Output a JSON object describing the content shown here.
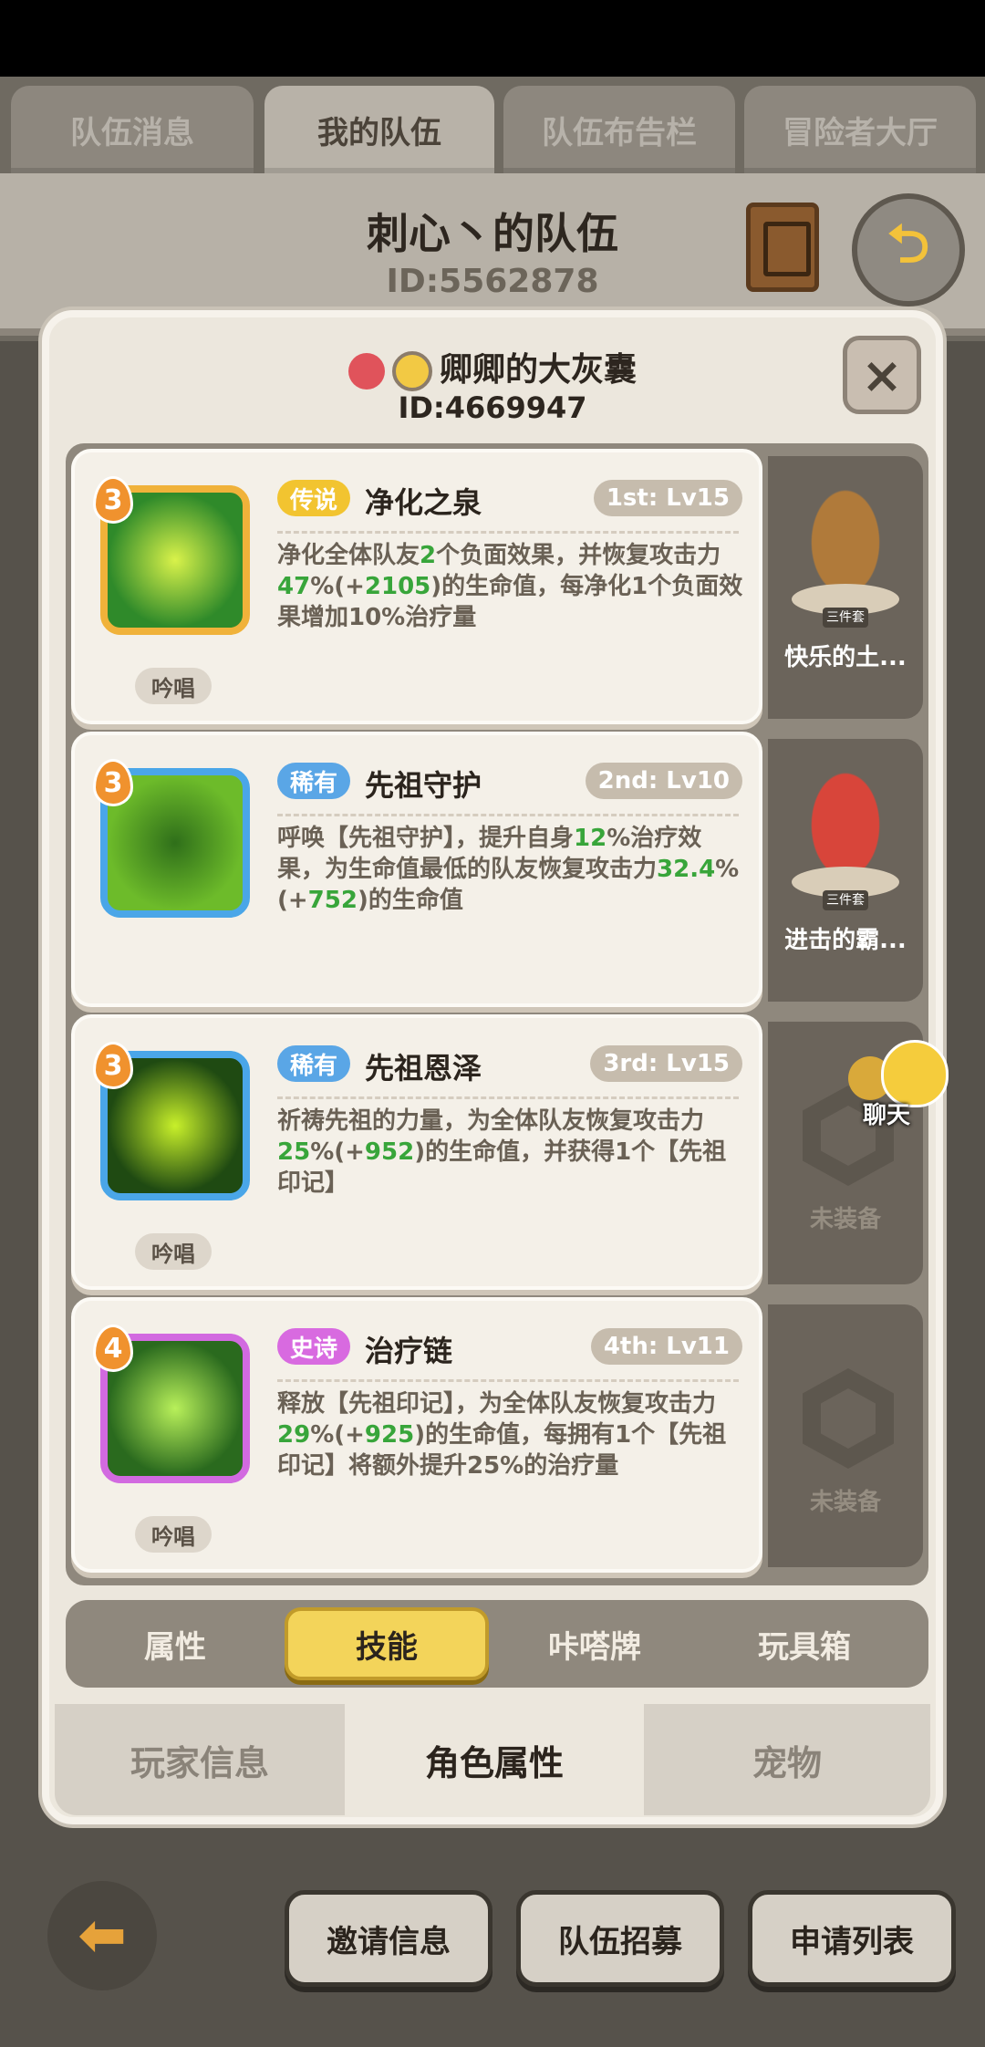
{
  "top_tabs": [
    {
      "label": "队伍消息"
    },
    {
      "label": "我的队伍"
    },
    {
      "label": "队伍布告栏"
    },
    {
      "label": "冒险者大厅"
    }
  ],
  "team": {
    "name": "刺心丶的队伍",
    "id": "ID:5562878"
  },
  "player": {
    "name": "卿卿的大灰囊",
    "id": "ID:4669947"
  },
  "skills": [
    {
      "level": "3",
      "rarity": "传说",
      "rarity_color": "#f2c430",
      "name": "净化之泉",
      "slot": "1st: Lv15",
      "desc_parts": [
        "净化全体队友",
        "2",
        "个负面效果，并恢复攻击力",
        "47",
        "%(+",
        "2105",
        ")的生命值，每净化1个负面效果增加10%治疗量"
      ],
      "chant": "吟唱",
      "icon_border": "#f0b23a",
      "icon_bg": "#2f8a2a",
      "icon_glow": "#d9f24a"
    },
    {
      "level": "3",
      "rarity": "稀有",
      "rarity_color": "#5aa6e6",
      "name": "先祖守护",
      "slot": "2nd: Lv10",
      "desc_parts": [
        "呼唤【先祖守护】，提升自身",
        "12",
        "%治疗效果，为生命值最低的队友恢复攻击力",
        "32.4",
        "%(+",
        "752",
        ")的生命值"
      ],
      "chant": "",
      "icon_border": "#4aa6e8",
      "icon_bg": "#6dbb2a",
      "icon_glow": "#2f6f1a"
    },
    {
      "level": "3",
      "rarity": "稀有",
      "rarity_color": "#5aa6e6",
      "name": "先祖恩泽",
      "slot": "3rd: Lv15",
      "desc_parts": [
        "祈祷先祖的力量，为全体队友恢复攻击力",
        "25",
        "%(+",
        "952",
        ")的生命值，并获得1个【先祖印记】",
        "",
        ""
      ],
      "chant": "吟唱",
      "icon_border": "#4aa6e8",
      "icon_bg": "#1f4a12",
      "icon_glow": "#c8f02a"
    },
    {
      "level": "4",
      "rarity": "史诗",
      "rarity_color": "#d86ae0",
      "name": "治疗链",
      "slot": "4th: Lv11",
      "desc_parts": [
        "释放【先祖印记】，为全体队友恢复攻击力",
        "29",
        "%(+",
        "925",
        ")的生命值，每拥有1个【先祖印记】将额外提升25%的治疗量",
        "",
        ""
      ],
      "chant": "吟唱",
      "icon_border": "#d26ae0",
      "icon_bg": "#2a6a1e",
      "icon_glow": "#b8f05a"
    }
  ],
  "pets": [
    {
      "name": "快乐的土...",
      "set_label": "三件套",
      "equipped": true,
      "color": "#b07a3a"
    },
    {
      "name": "进击的霸...",
      "set_label": "三件套",
      "equipped": true,
      "color": "#d8453a"
    },
    {
      "name": "未装备",
      "equipped": false
    },
    {
      "name": "未装备",
      "equipped": false
    }
  ],
  "chat": {
    "label": "聊天"
  },
  "sub_tabs": [
    {
      "label": "属性"
    },
    {
      "label": "技能"
    },
    {
      "label": "咔嗒牌"
    },
    {
      "label": "玩具箱"
    }
  ],
  "bottom_tabs": [
    {
      "label": "玩家信息"
    },
    {
      "label": "角色属性"
    },
    {
      "label": "宠物"
    }
  ],
  "bottom_buttons": [
    {
      "label": "邀请信息"
    },
    {
      "label": "队伍招募"
    },
    {
      "label": "申请列表"
    }
  ],
  "close_symbol": "×",
  "back_symbol": "⮌"
}
